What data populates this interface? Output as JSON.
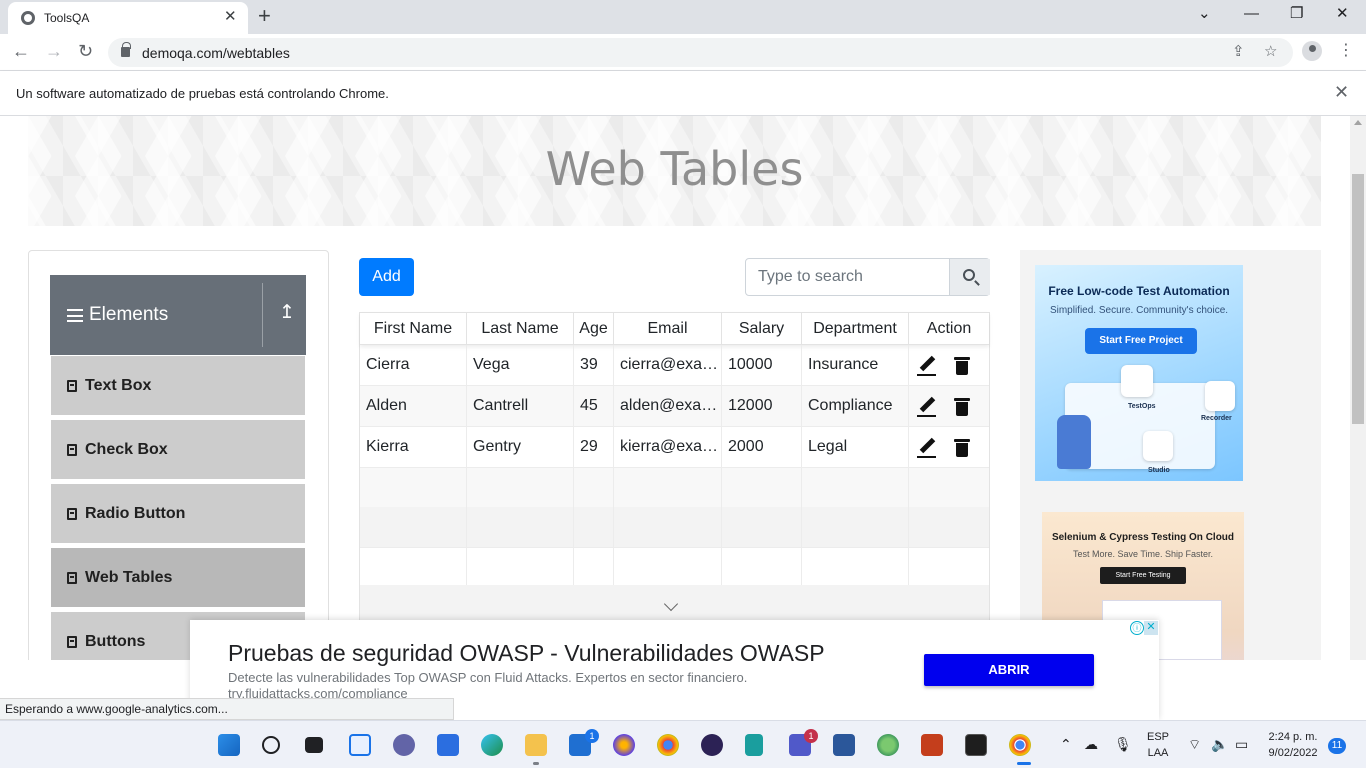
{
  "browser": {
    "tab_title": "ToolsQA",
    "tab_close": "✕",
    "new_tab": "+",
    "url": "demoqa.com/webtables",
    "infobar_text": "Un software automatizado de pruebas está controlando Chrome.",
    "infobar_close": "✕",
    "status_text": "Esperando a www.google-analytics.com..."
  },
  "page": {
    "title": "Web Tables",
    "sidebar": {
      "group_title": "Elements",
      "items": [
        {
          "label": "Text Box"
        },
        {
          "label": "Check Box"
        },
        {
          "label": "Radio Button"
        },
        {
          "label": "Web Tables"
        },
        {
          "label": "Buttons"
        }
      ]
    },
    "add_label": "Add",
    "search_placeholder": "Type to search",
    "table": {
      "headers": [
        "First Name",
        "Last Name",
        "Age",
        "Email",
        "Salary",
        "Department",
        "Action"
      ],
      "rows": [
        [
          "Cierra",
          "Vega",
          "39",
          "cierra@example.com",
          "10000",
          "Insurance"
        ],
        [
          "Alden",
          "Cantrell",
          "45",
          "alden@example.com",
          "12000",
          "Compliance"
        ],
        [
          "Kierra",
          "Gentry",
          "29",
          "kierra@example.com",
          "2000",
          "Legal"
        ]
      ]
    }
  },
  "ads": {
    "right1": {
      "title": "Free Low-code Test Automation",
      "subtitle": "Simplified. Secure. Community's choice.",
      "cta": "Start Free Project",
      "labels": [
        "TestOps",
        "Recorder",
        "Studio"
      ]
    },
    "right2": {
      "title": "Selenium & Cypress Testing On Cloud",
      "subtitle": "Test More. Save Time. Ship Faster.",
      "cta": "Start Free Testing"
    },
    "bottom": {
      "title": "Pruebas de seguridad OWASP - Vulnerabilidades OWASP",
      "description": "Detecte las vulnerabilidades Top OWASP con Fluid Attacks. Expertos en sector financiero. try.fluidattacks.com/compliance",
      "cta": "ABRIR",
      "adchoices": "ⓘ",
      "close": "✕"
    }
  },
  "taskbar": {
    "language": "ESP",
    "layout": "LAA",
    "time": "2:24 p. m.",
    "date": "9/02/2022",
    "notifications": "11",
    "mail_badge": "1",
    "teams_badge": "1"
  }
}
